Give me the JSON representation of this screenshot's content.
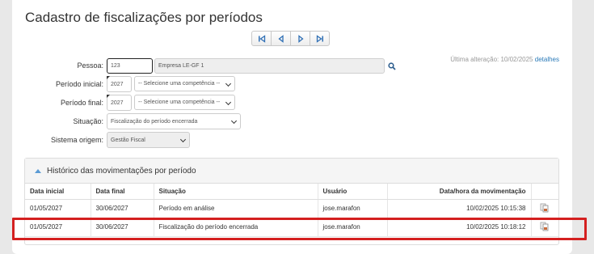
{
  "page": {
    "title": "Cadastro de fiscalizações por períodos"
  },
  "pager": {
    "first_icon": "first-page-icon",
    "prev_icon": "prev-page-icon",
    "next_icon": "next-page-icon",
    "last_icon": "last-page-icon"
  },
  "form": {
    "pessoa_label": "Pessoa:",
    "pessoa_code": "123",
    "pessoa_name": "Empresa LE-GF 1",
    "periodo_inicial_label": "Período inicial:",
    "periodo_inicial_year": "2027",
    "periodo_inicial_select": "-- Selecione uma competência --",
    "periodo_final_label": "Período final:",
    "periodo_final_year": "2027",
    "periodo_final_select": "-- Selecione uma competência --",
    "situacao_label": "Situação:",
    "situacao_value": "Fiscalização do período encerrada",
    "sistema_label": "Sistema origem:",
    "sistema_value": "Gestão Fiscal"
  },
  "last_change": {
    "text": "Última alteração: 10/02/2025",
    "link": "detalhes"
  },
  "history": {
    "title": "Histórico das movimentações por período",
    "columns": [
      "Data inicial",
      "Data final",
      "Situação",
      "Usuário",
      "Data/hora da movimentação"
    ],
    "rows": [
      {
        "data_inicial": "01/05/2027",
        "data_final": "30/06/2027",
        "situacao": "Período em análise",
        "usuario": "jose.marafon",
        "data_hora": "10/02/2025 10:15:38"
      },
      {
        "data_inicial": "01/05/2027",
        "data_final": "30/06/2027",
        "situacao": "Fiscalização do período encerrada",
        "usuario": "jose.marafon",
        "data_hora": "10/02/2025 10:18:12"
      }
    ]
  },
  "colors": {
    "highlight": "#d42020",
    "link": "#2a7ab8",
    "pager_icon": "#2f6fb5"
  }
}
